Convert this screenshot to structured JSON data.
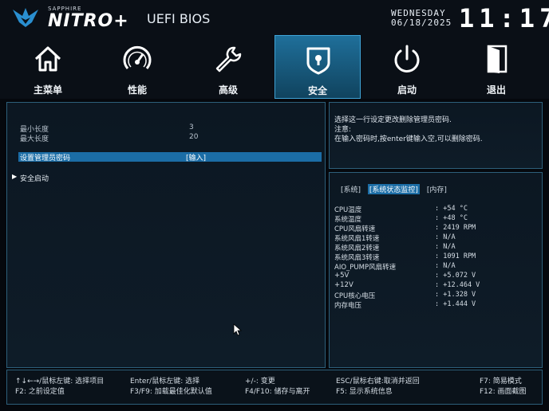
{
  "header": {
    "brand_small": "SAPPHIRE",
    "brand_big": "NITRO+",
    "title": "UEFI BIOS",
    "weekday": "WEDNESDAY",
    "date": "06/18/2025",
    "time": "11:17"
  },
  "nav": {
    "tabs": [
      {
        "label": "主菜单",
        "icon": "home-icon"
      },
      {
        "label": "性能",
        "icon": "speedometer-icon"
      },
      {
        "label": "高级",
        "icon": "wrench-icon"
      },
      {
        "label": "安全",
        "icon": "shield-lock-icon",
        "active": true
      },
      {
        "label": "启动",
        "icon": "power-icon"
      },
      {
        "label": "退出",
        "icon": "exit-door-icon"
      }
    ]
  },
  "security": {
    "min_length_label": "最小长度",
    "min_length_value": "3",
    "max_length_label": "最大长度",
    "max_length_value": "20",
    "admin_password_label": "设置管理员密码",
    "admin_password_value": "[输入]",
    "secure_boot_label": "安全启动"
  },
  "help": {
    "line1": "选择这一行设定更改删除管理员密码.",
    "line2": "注意:",
    "line3": "在输入密码时,按enter键输入空,可以删除密码."
  },
  "hw_monitor": {
    "tabs": [
      "[系统]",
      "[系统状态监控]",
      "[内存]"
    ],
    "active_tab": 1,
    "items": [
      {
        "name": "CPU温度",
        "value": ": +54 °C"
      },
      {
        "name": "系统温度",
        "value": ": +48 °C"
      },
      {
        "name": "CPU风扇转速",
        "value": ": 2419 RPM"
      },
      {
        "name": "系统风扇1转速",
        "value": ": N/A"
      },
      {
        "name": "系统风扇2转速",
        "value": ": N/A"
      },
      {
        "name": "系统风扇3转速",
        "value": ": 1091 RPM"
      },
      {
        "name": "AIO_PUMP风扇转速",
        "value": ": N/A"
      },
      {
        "name": "+5V",
        "value": ": +5.072 V"
      },
      {
        "name": "+12V",
        "value": ": +12.464 V"
      },
      {
        "name": "CPU核心电压",
        "value": ": +1.328 V"
      },
      {
        "name": "内存电压",
        "value": ": +1.444 V"
      }
    ]
  },
  "footer": {
    "k1": "↑↓←→/鼠标左键: 选择项目",
    "k2": "F2: 之前设定值",
    "k3": "Enter/鼠标左键: 选择",
    "k4": "F3/F9: 加载最佳化默认值",
    "k5": "+/-: 变更",
    "k6": "F4/F10: 储存与离开",
    "k7": "ESC/鼠标右键:取消并返回",
    "k8": "F5: 显示系统信息",
    "k9": "F7: 简易模式",
    "k10": "F12: 画面截图"
  },
  "colors": {
    "accent": "#1b6da6",
    "border": "#2d5f7a",
    "active_tab": "#1f6f9a"
  }
}
